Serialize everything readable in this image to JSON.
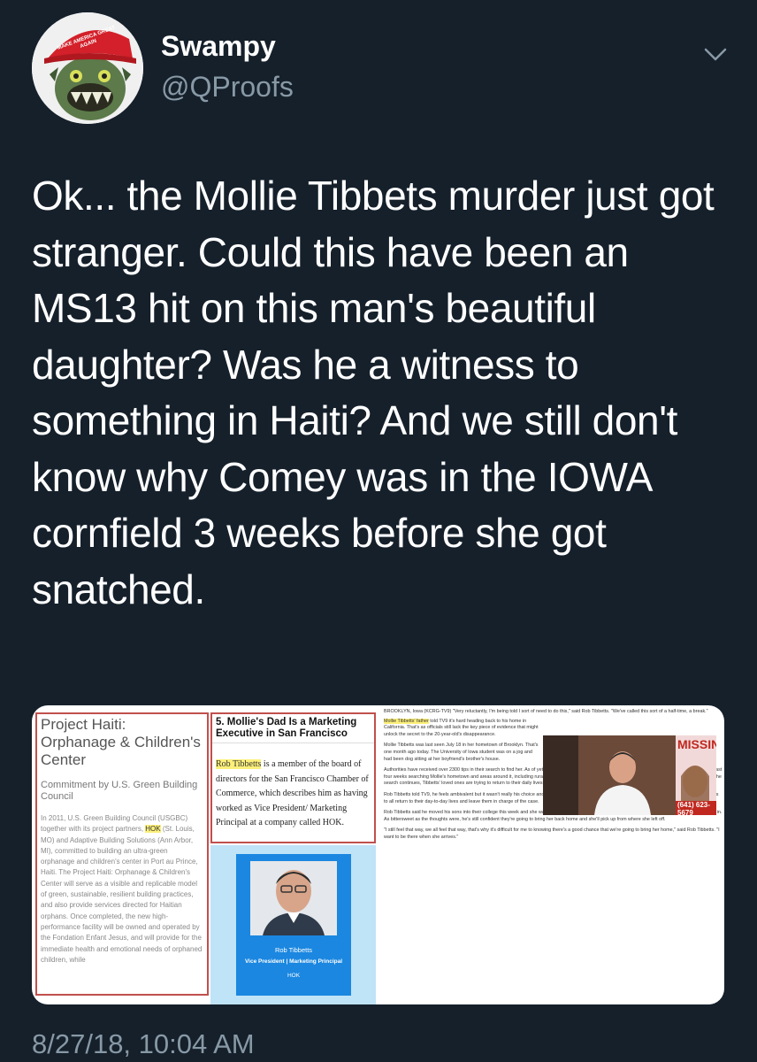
{
  "tweet": {
    "display_name": "Swampy",
    "handle": "@QProofs",
    "avatar_hat_text": "MAKE AMERICA GREAT AGAIN",
    "text": "Ok... the Mollie Tibbets murder just got stranger. Could this have been an MS13 hit on this man's beautiful daughter? Was he a witness to something in Haiti? And we still don't know why Comey was in the IOWA cornfield 3 weeks before she got snatched.",
    "timestamp": "8/27/18, 10:04 AM"
  },
  "media": {
    "panel1": {
      "title": "Project Haiti: Orphanage & Children's Center",
      "subtitle": "Commitment by U.S. Green Building Council",
      "body_before": "In 2011, U.S. Green Building Council (USGBC) together with its project partners, ",
      "body_highlight": "HOK",
      "body_after": " (St. Louis, MO) and Adaptive Building Solutions (Ann Arbor, MI), committed to building an ultra-green orphanage and children's center in Port au Prince, Haiti. The Project Haiti: Orphanage & Children's Center will serve as a visible and replicable model of green, sustainable, resilient building practices, and also provide services directed for Haitian orphans. Once completed, the new high-performance facility will be owned and operated by the Fondation Enfant Jesus, and will provide for the immediate health and emotional needs of orphaned children, while"
    },
    "panel2": {
      "title": "5. Mollie's Dad Is a Marketing Executive in San Francisco",
      "body_highlight": "Rob Tibbetts",
      "body_text": " is a member of the board of directors for the San Francisco Chamber of Commerce, which describes him as having worked as Vice President/ Marketing Principal at a company called HOK."
    },
    "panel3": {
      "name": "Rob Tibbetts",
      "role": "Vice President | Marketing Principal",
      "org": "HOK"
    },
    "panel4": {
      "intro": "BROOKLYN, Iowa (KCRG-TV9) \"Very reluctantly, I'm being told I sort of need to do this,\" said Rob Tibbetts. \"We've called this sort of a half-time, a break.\"",
      "p1_highlight": "Mollie Tibbetts' father",
      "p1_text": " told TV9 it's hard heading back to his home in California. That's as officials still lack the key piece of evidence that might unlock the secret to the 20-year-old's disappearance.",
      "p2": "Mollie Tibbetts was last seen July 18 in her hometown of Brooklyn. That's one month ago today. The University of Iowa student was on a jog and had been dog sitting at her boyfriend's brother's house.",
      "p3": "Authorities have received over 2300 tips in their search to find her. As of yet, none have led to a definitive answer. Volunteers and law enforcement spent the last four weeks searching Mollie's hometown and areas around it, including rural farmland. A reward to bring her home safely is more than 366,000 dollars. While the search continues, Tibbetts' loved ones are trying to return to their daily lives. Her father, who works and lives in California, returned home Saturday.",
      "p4": "Rob Tibbetts told TV9, he feels ambivalent but it wasn't really his choice and probably for the best. He said law enforcement has been encouraging the Tibbetts to all return to their day-to-day lives and leave them in charge of the case.",
      "p5": "Rob Tibbetts said he moved his sons into their college this week and she was on their minds. That's because they passed by where Mollie was going to move in. As bittersweet as the thoughts were, he's still confident they're going to bring her back home and she'll pick up from where she left off.",
      "p6": "\"I still feel that way, we all feel that way, that's why it's difficult for me to knowing there's a good chance that we're going to bring her home,\" said Rob Tibbetts. \"I want to be there when she arrives.\"",
      "poster_title": "MISSING",
      "poster_phone": "(641) 623-5679"
    }
  },
  "colors": {
    "background": "#15202b",
    "text_primary": "#ffffff",
    "text_secondary": "#8899a6",
    "highlight": "#fdf07a",
    "panel_border": "#c0504d"
  },
  "icons": {
    "menu": "chevron-down-icon"
  }
}
